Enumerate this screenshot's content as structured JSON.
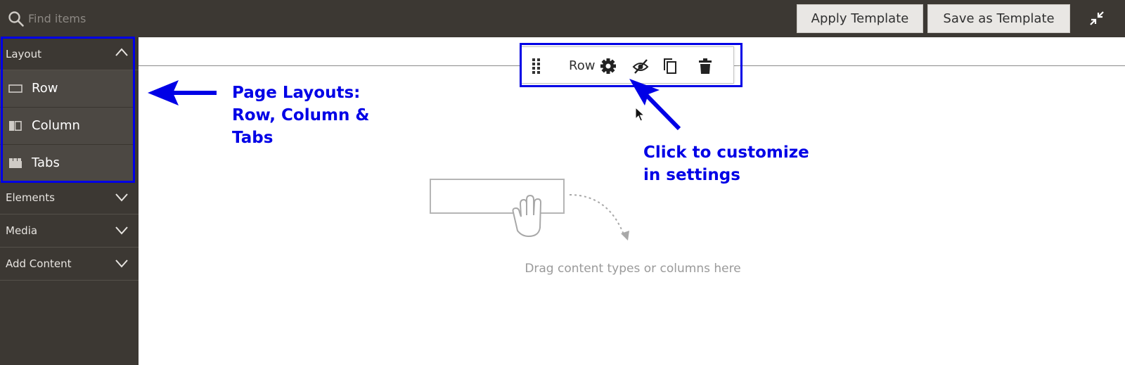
{
  "search": {
    "placeholder": "Find items",
    "icon": "search-icon"
  },
  "header": {
    "apply_template_label": "Apply Template",
    "save_template_label": "Save as Template",
    "collapse_icon": "collapse-icon"
  },
  "sidebar": {
    "panels": [
      {
        "label": "Layout",
        "expanded": true
      },
      {
        "label": "Elements",
        "expanded": false
      },
      {
        "label": "Media",
        "expanded": false
      },
      {
        "label": "Add Content",
        "expanded": false
      }
    ],
    "layout_items": [
      {
        "label": "Row",
        "icon": "row-icon"
      },
      {
        "label": "Column",
        "icon": "column-icon"
      },
      {
        "label": "Tabs",
        "icon": "tabs-icon"
      }
    ]
  },
  "stage": {
    "toolbar": {
      "label": "Row",
      "icons": [
        "drag-handle-icon",
        "settings-gear-icon",
        "hide-eye-icon",
        "duplicate-icon",
        "trash-icon"
      ]
    },
    "drop_hint": "Drag content types or columns here"
  },
  "annotations": {
    "layouts_line1": "Page Layouts:",
    "layouts_line2": "Row, Column &",
    "layouts_line3": "Tabs",
    "settings_line1": "Click to customize",
    "settings_line2": "in settings"
  },
  "colors": {
    "chrome_dark": "#3c3833",
    "sidebar_item_bg": "#4c4843",
    "annotation_blue": "#0000e6"
  }
}
